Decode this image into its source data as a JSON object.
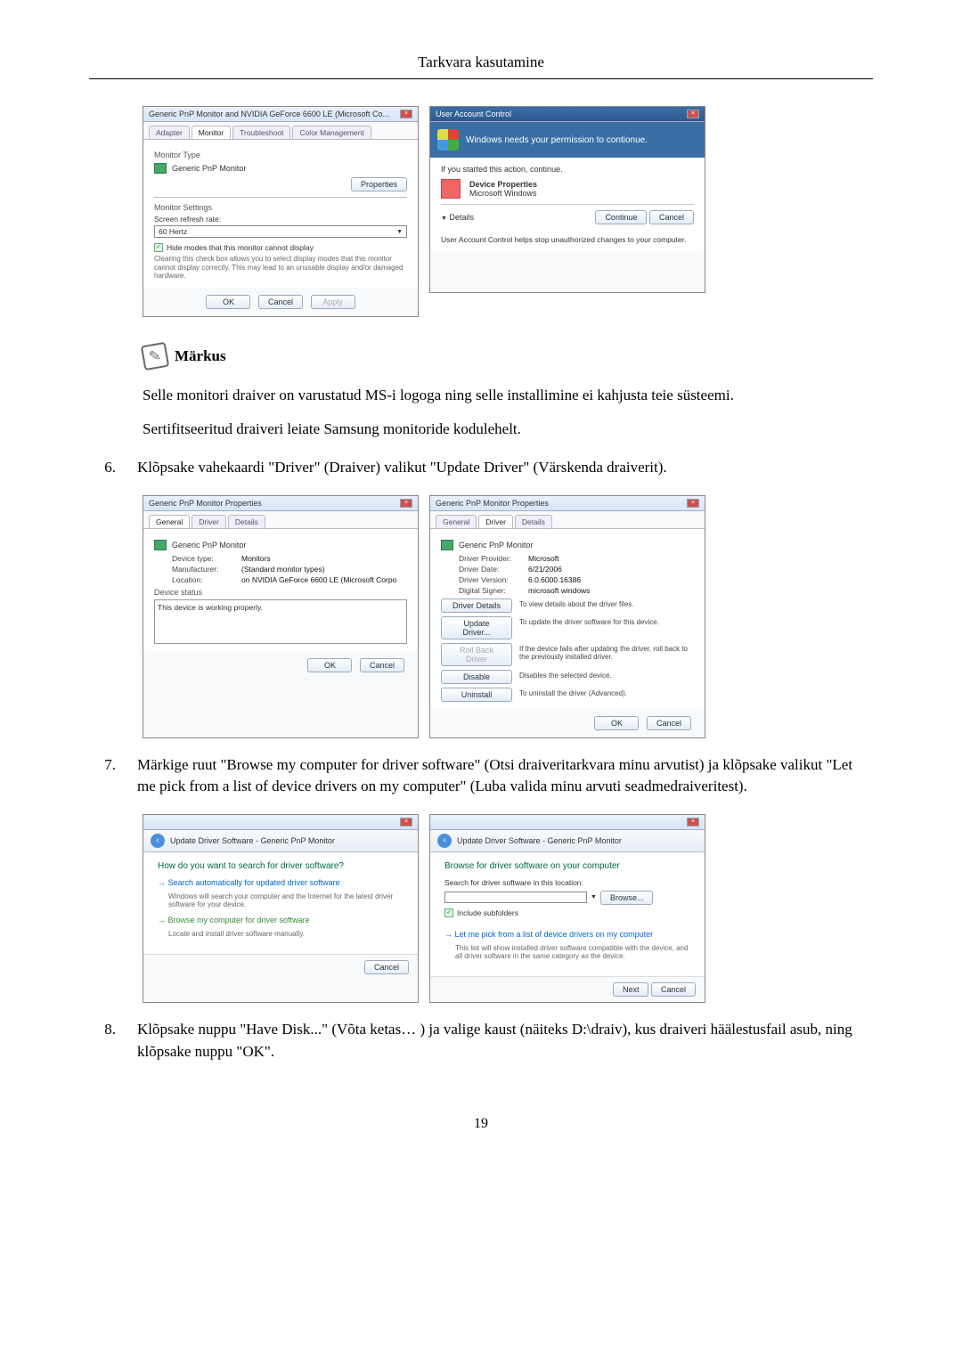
{
  "header": "Tarkvara kasutamine",
  "page_number": "19",
  "note": {
    "label": "Märkus",
    "para1": "Selle monitori draiver on varustatud MS-i logoga ning selle installimine ei kahjusta teie süsteemi.",
    "para2": "Sertifitseeritud draiveri leiate Samsung monitoride kodulehelt."
  },
  "steps": {
    "s6": {
      "num": "6.",
      "text": "Klõpsake vahekaardi \"Driver\" (Draiver) valikut \"Update Driver\" (Värskenda draiverit)."
    },
    "s7": {
      "num": "7.",
      "text": "Märkige ruut \"Browse my computer for driver software\" (Otsi draiveritarkvara minu arvutist) ja klõpsake valikut \"Let me pick from a list of device drivers on my computer\" (Luba valida minu arvuti seadmedraiveritest)."
    },
    "s8": {
      "num": "8.",
      "text": "Klõpsake nuppu \"Have Disk...\" (Võta ketas… ) ja valige kaust (näiteks D:\\draiv), kus draiveri häälestusfail asub, ning klõpsake nuppu \"OK\"."
    }
  },
  "dlg1": {
    "title": "Generic PnP Monitor and NVIDIA GeForce 6600 LE (Microsoft Co...",
    "tabs": [
      "Adapter",
      "Monitor",
      "Troubleshoot",
      "Color Management"
    ],
    "monitor_type_lbl": "Monitor Type",
    "monitor_name": "Generic PnP Monitor",
    "properties_btn": "Properties",
    "monitor_settings_lbl": "Monitor Settings",
    "refresh_lbl": "Screen refresh rate:",
    "refresh_val": "60 Hertz",
    "hide_chk": "Hide modes that this monitor cannot display",
    "hide_desc": "Clearing this check box allows you to select display modes that this monitor cannot display correctly. This may lead to an unusable display and/or damaged hardware.",
    "ok": "OK",
    "cancel": "Cancel",
    "apply": "Apply"
  },
  "uac": {
    "title": "User Account Control",
    "banner": "Windows needs your permission to contionue.",
    "started": "If you started this action, continue.",
    "prog_name": "Device Properties",
    "prog_pub": "Microsoft Windows",
    "details": "Details",
    "continue": "Continue",
    "cancel": "Cancel",
    "footer": "User Account Control helps stop unauthorized changes to your computer."
  },
  "props_general": {
    "title": "Generic PnP Monitor Properties",
    "tabs": [
      "General",
      "Driver",
      "Details"
    ],
    "name": "Generic PnP Monitor",
    "dev_type_lbl": "Device type:",
    "dev_type_val": "Monitors",
    "manuf_lbl": "Manufacturer:",
    "manuf_val": "(Standard monitor types)",
    "loc_lbl": "Location:",
    "loc_val": "on NVIDIA GeForce 6600 LE (Microsoft Corpo",
    "status_lbl": "Device status",
    "status_val": "This device is working properly.",
    "ok": "OK",
    "cancel": "Cancel"
  },
  "props_driver": {
    "title": "Generic PnP Monitor Properties",
    "tabs": [
      "General",
      "Driver",
      "Details"
    ],
    "name": "Generic PnP Monitor",
    "prov_lbl": "Driver Provider:",
    "prov_val": "Microsoft",
    "date_lbl": "Driver Date:",
    "date_val": "6/21/2006",
    "ver_lbl": "Driver Version:",
    "ver_val": "6.0.6000.16386",
    "signer_lbl": "Digital Signer:",
    "signer_val": "microsoft windows",
    "btn_details": "Driver Details",
    "desc_details": "To view details about the driver files.",
    "btn_update": "Update Driver...",
    "desc_update": "To update the driver software for this device.",
    "btn_rollback": "Roll Back Driver",
    "desc_rollback": "If the device fails after updating the driver, roll back to the previously installed driver.",
    "btn_disable": "Disable",
    "desc_disable": "Disables the selected device.",
    "btn_uninstall": "Uninstall",
    "desc_uninstall": "To uninstall the driver (Advanced).",
    "ok": "OK",
    "cancel": "Cancel"
  },
  "wiz1": {
    "crumb": "Update Driver Software - Generic PnP Monitor",
    "heading": "How do you want to search for driver software?",
    "opt1": "Search automatically for updated driver software",
    "opt1_sub": "Windows will search your computer and the Internet for the latest driver software for your device.",
    "opt2": "Browse my computer for driver software",
    "opt2_sub": "Locate and install driver software manually.",
    "cancel": "Cancel"
  },
  "wiz2": {
    "crumb": "Update Driver Software - Generic PnP Monitor",
    "heading": "Browse for driver software on your computer",
    "search_lbl": "Search for driver software in this location:",
    "browse": "Browse...",
    "include_sub": "Include subfolders",
    "pick_opt": "Let me pick from a list of device drivers on my computer",
    "pick_sub": "This list will show installed driver software compatible with the device, and all driver software in the same category as the device.",
    "next": "Next",
    "cancel": "Cancel"
  }
}
